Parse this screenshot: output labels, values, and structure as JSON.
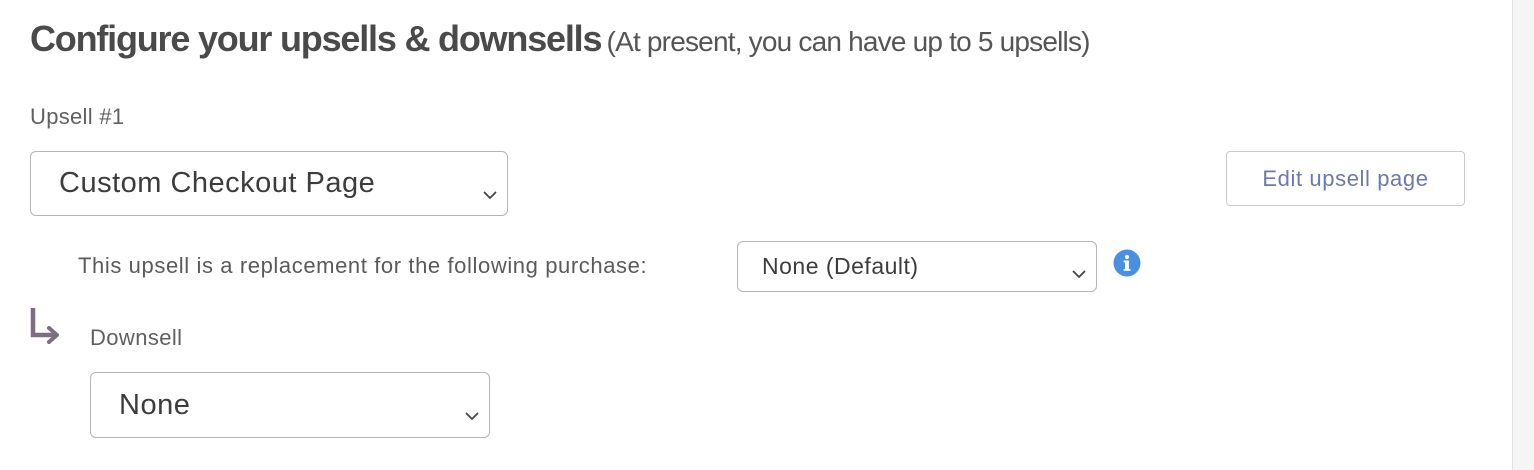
{
  "heading": {
    "title": "Configure your upsells & downsells",
    "subtitle": "(At present, you can have up to 5 upsells)"
  },
  "upsell": {
    "label": "Upsell #1",
    "selected_page": "Custom Checkout Page",
    "edit_button_label": "Edit upsell page",
    "replacement_label": "This upsell is a replacement for the following purchase:",
    "replacement_selected": "None (Default)"
  },
  "downsell": {
    "label": "Downsell",
    "selected": "None"
  },
  "icons": {
    "dropdown": "chevron-down-icon",
    "info": "info-icon",
    "downsell_arrow": "arrow-down-right-icon"
  },
  "colors": {
    "heading_text": "#4a4a4a",
    "body_text": "#555555",
    "button_text": "#6b7aa8",
    "info_blue": "#4a90e2",
    "arrow_gray": "#7d6f82",
    "border": "#b5b5b5"
  }
}
